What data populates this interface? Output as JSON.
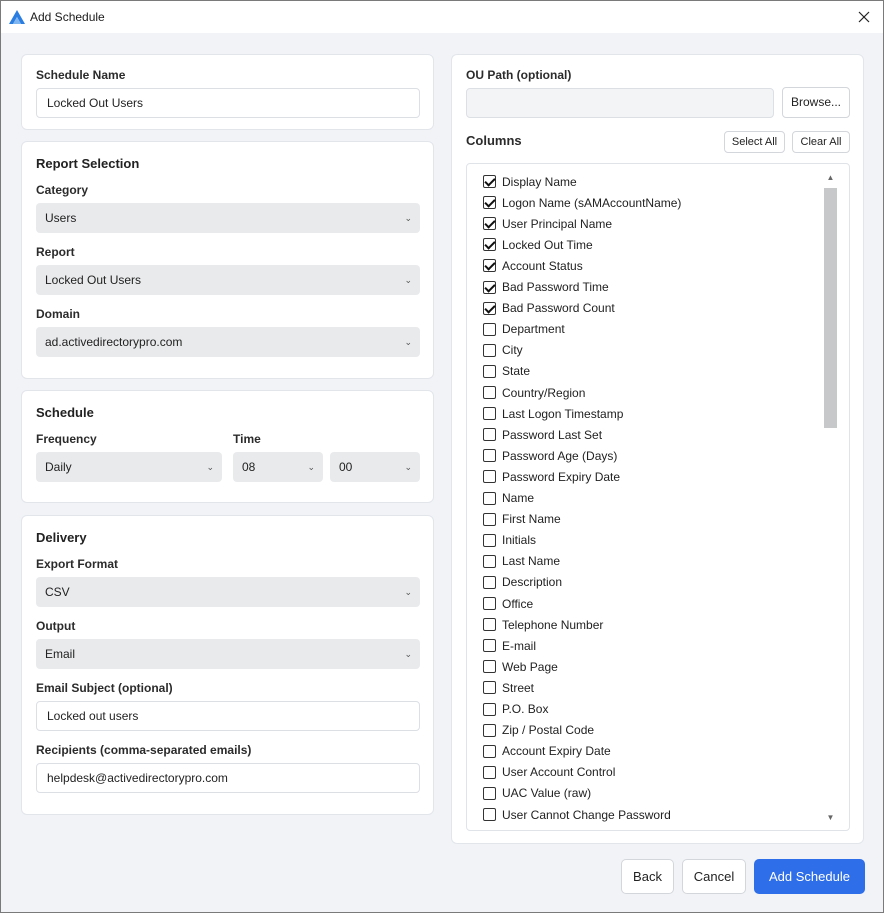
{
  "window": {
    "title": "Add Schedule"
  },
  "schedule_name": {
    "label": "Schedule Name",
    "value": "Locked Out Users"
  },
  "report_selection": {
    "title": "Report Selection",
    "category_label": "Category",
    "category_value": "Users",
    "report_label": "Report",
    "report_value": "Locked Out Users",
    "domain_label": "Domain",
    "domain_value": "ad.activedirectorypro.com"
  },
  "schedule": {
    "title": "Schedule",
    "frequency_label": "Frequency",
    "frequency_value": "Daily",
    "time_label": "Time",
    "hour_value": "08",
    "minute_value": "00"
  },
  "delivery": {
    "title": "Delivery",
    "format_label": "Export Format",
    "format_value": "CSV",
    "output_label": "Output",
    "output_value": "Email",
    "subject_label": "Email Subject (optional)",
    "subject_value": "Locked out users",
    "recipients_label": "Recipients (comma-separated emails)",
    "recipients_value": "helpdesk@activedirectorypro.com"
  },
  "ou_path": {
    "label": "OU Path (optional)",
    "value": "",
    "browse_label": "Browse..."
  },
  "columns": {
    "title": "Columns",
    "select_all_label": "Select All",
    "clear_all_label": "Clear All",
    "items": [
      {
        "label": "Display Name",
        "checked": true
      },
      {
        "label": "Logon Name (sAMAccountName)",
        "checked": true
      },
      {
        "label": "User Principal Name",
        "checked": true
      },
      {
        "label": "Locked Out Time",
        "checked": true
      },
      {
        "label": "Account Status",
        "checked": true
      },
      {
        "label": "Bad Password Time",
        "checked": true
      },
      {
        "label": "Bad Password Count",
        "checked": true
      },
      {
        "label": "Department",
        "checked": false
      },
      {
        "label": "City",
        "checked": false
      },
      {
        "label": "State",
        "checked": false
      },
      {
        "label": "Country/Region",
        "checked": false
      },
      {
        "label": "Last Logon Timestamp",
        "checked": false
      },
      {
        "label": "Password Last Set",
        "checked": false
      },
      {
        "label": "Password Age (Days)",
        "checked": false
      },
      {
        "label": "Password Expiry Date",
        "checked": false
      },
      {
        "label": "Name",
        "checked": false
      },
      {
        "label": "First Name",
        "checked": false
      },
      {
        "label": "Initials",
        "checked": false
      },
      {
        "label": "Last Name",
        "checked": false
      },
      {
        "label": "Description",
        "checked": false
      },
      {
        "label": "Office",
        "checked": false
      },
      {
        "label": "Telephone Number",
        "checked": false
      },
      {
        "label": "E-mail",
        "checked": false
      },
      {
        "label": "Web Page",
        "checked": false
      },
      {
        "label": "Street",
        "checked": false
      },
      {
        "label": "P.O. Box",
        "checked": false
      },
      {
        "label": "Zip / Postal Code",
        "checked": false
      },
      {
        "label": "Account Expiry Date",
        "checked": false
      },
      {
        "label": "User Account Control",
        "checked": false
      },
      {
        "label": "UAC Value (raw)",
        "checked": false
      },
      {
        "label": "User Cannot Change Password",
        "checked": false
      }
    ]
  },
  "footer": {
    "back_label": "Back",
    "cancel_label": "Cancel",
    "add_label": "Add Schedule"
  },
  "colors": {
    "primary": "#2e6ee8",
    "window_bg": "#f1f3f7",
    "card_bg": "#ffffff",
    "select_bg": "#e9eaec"
  }
}
